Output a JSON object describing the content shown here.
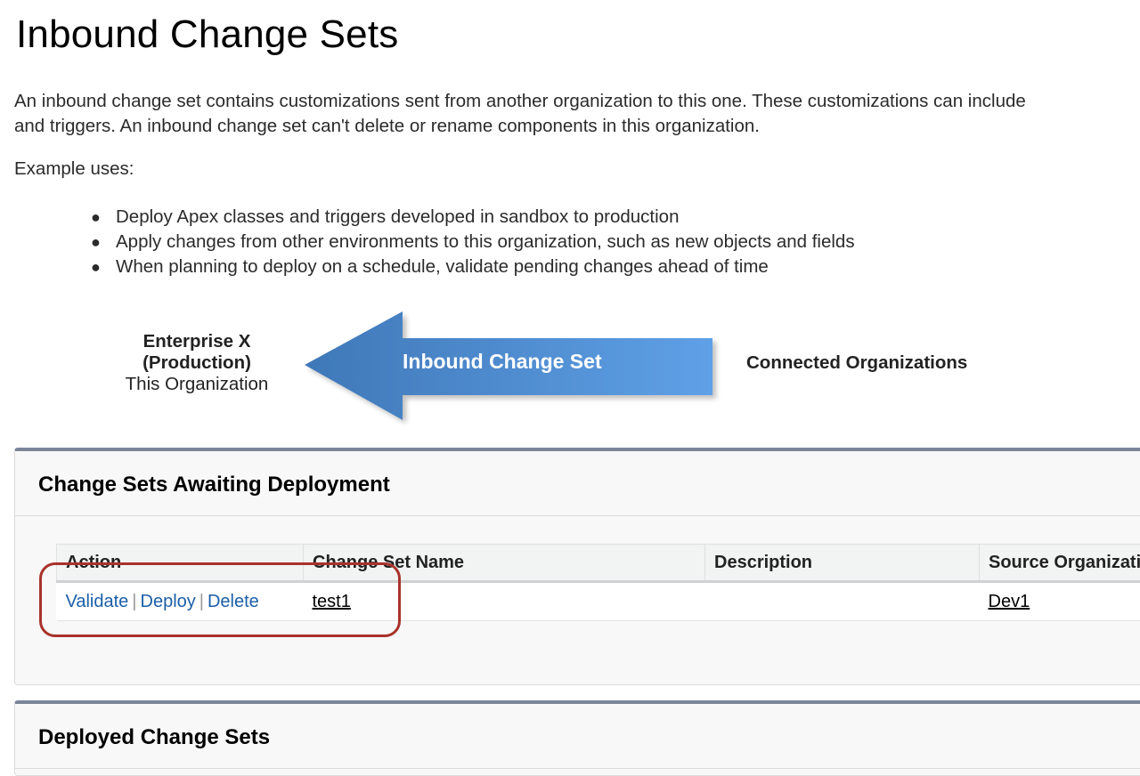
{
  "page": {
    "title": "Inbound Change Sets",
    "intro_line1": "An inbound change set contains customizations sent from another organization to this one. These customizations can include",
    "intro_line2": "and triggers. An inbound change set can't delete or rename components in this organization.",
    "example_label": "Example uses:",
    "example_uses": [
      "Deploy Apex classes and triggers developed in sandbox to production",
      "Apply changes from other environments to this organization, such as new objects and fields",
      "When planning to deploy on a schedule, validate pending changes ahead of time"
    ]
  },
  "diagram": {
    "this_org_name_line1": "Enterprise X",
    "this_org_name_line2": "(Production)",
    "this_org_sub": "This Organization",
    "arrow_label": "Inbound Change Set",
    "connected_label": "Connected Organizations",
    "arrow_color_light": "#5fa0e6",
    "arrow_color_dark": "#3f78b8"
  },
  "awaiting": {
    "title": "Change Sets Awaiting Deployment",
    "columns": [
      "Action",
      "Change Set Name",
      "Description",
      "Source Organizati"
    ],
    "rows": [
      {
        "actions": [
          "Validate",
          "Deploy",
          "Delete"
        ],
        "separator": "|",
        "name": "test1",
        "description": "",
        "source_org": "Dev1"
      }
    ]
  },
  "deployed": {
    "title": "Deployed Change Sets"
  },
  "colors": {
    "link_blue": "#1b5fa8",
    "panel_top_border": "#7a8599",
    "highlight_red": "#a8332a"
  }
}
